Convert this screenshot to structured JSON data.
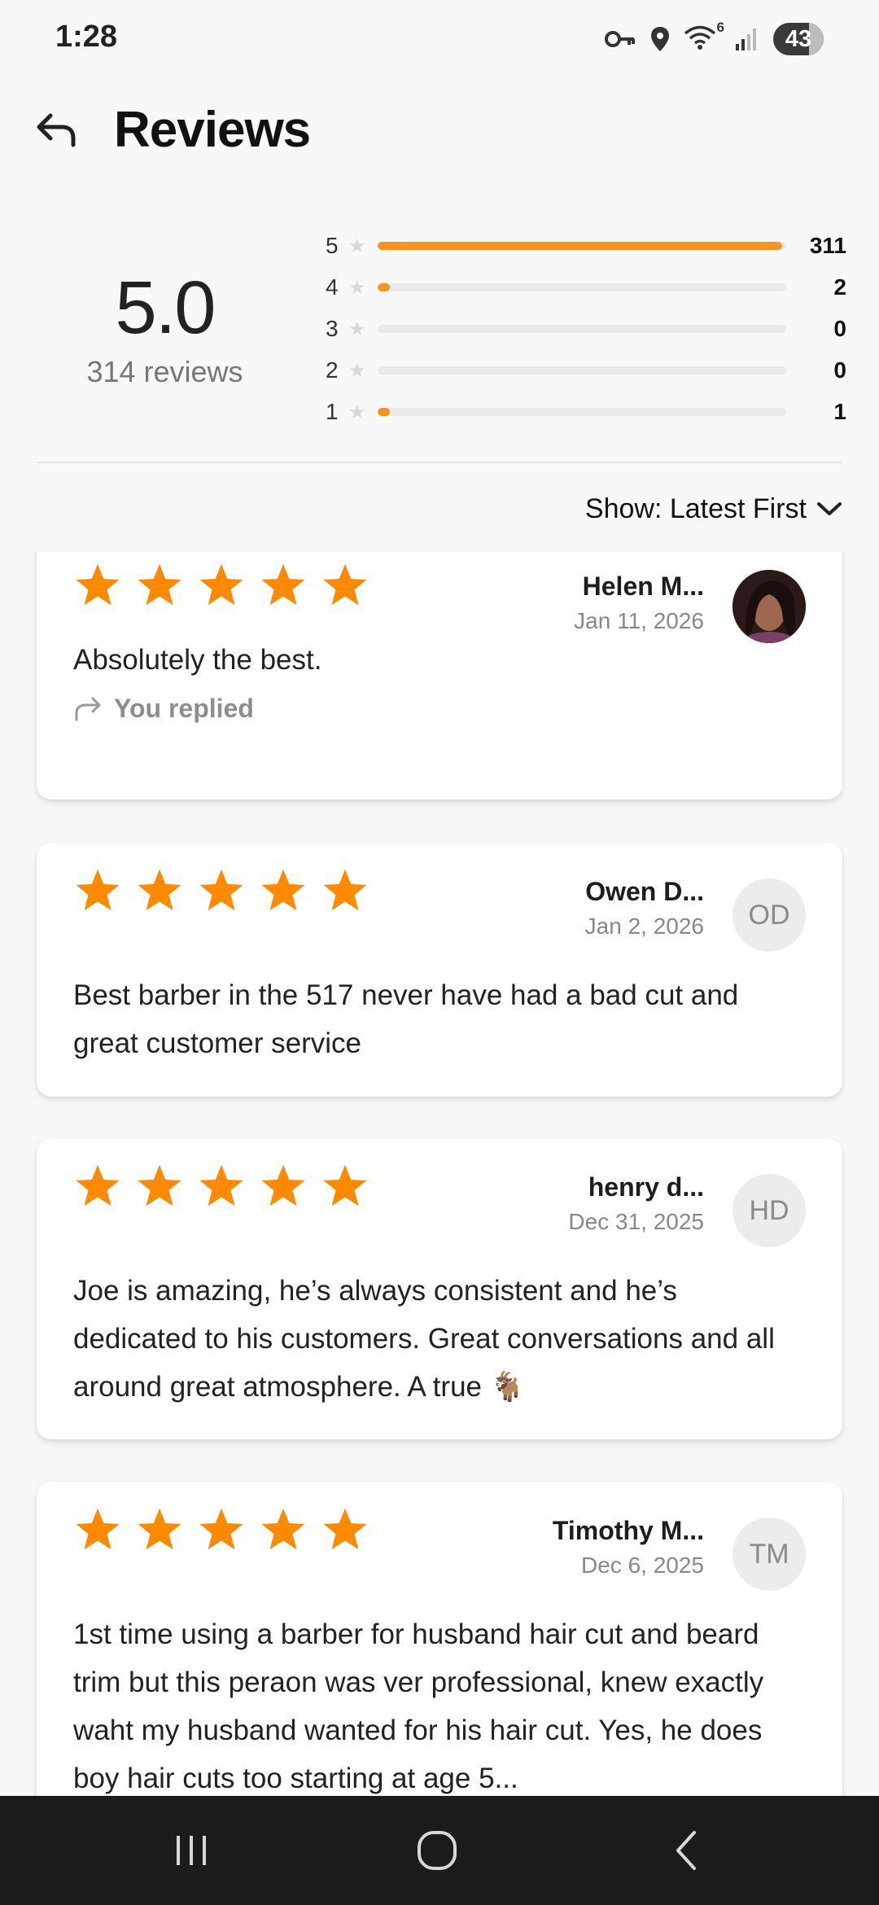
{
  "status_bar": {
    "time": "1:28",
    "wifi_badge": "6",
    "battery": "43",
    "icons": [
      "key-icon",
      "location-icon",
      "wifi-icon",
      "signal-icon",
      "battery-icon"
    ]
  },
  "header": {
    "title": "Reviews",
    "back_icon": "back-arrow-icon"
  },
  "summary": {
    "average": "5.0",
    "count_label": "314 reviews",
    "distribution": [
      {
        "stars": "5",
        "count": "311",
        "fraction": 0.99
      },
      {
        "stars": "4",
        "count": "2",
        "fraction": 0.03
      },
      {
        "stars": "3",
        "count": "0",
        "fraction": 0
      },
      {
        "stars": "2",
        "count": "0",
        "fraction": 0
      },
      {
        "stars": "1",
        "count": "1",
        "fraction": 0.03
      }
    ]
  },
  "sort": {
    "label": "Show: Latest First",
    "icon": "chevron-down-icon"
  },
  "reviews": [
    {
      "name": "Helen M...",
      "date": "Jan 11, 2026",
      "initials": "",
      "avatar": "photo",
      "rating": 5,
      "text": "Absolutely the best.",
      "replied_label": "You replied"
    },
    {
      "name": "Owen D...",
      "date": "Jan 2, 2026",
      "initials": "OD",
      "rating": 5,
      "text": "Best barber in the 517 never have had a bad cut and great customer service"
    },
    {
      "name": "henry d...",
      "date": "Dec 31, 2025",
      "initials": "HD",
      "rating": 5,
      "text": "Joe is amazing, he’s always consistent and he’s dedicated to his customers. Great conversations and all around great atmosphere. A true 🐐"
    },
    {
      "name": "Timothy M...",
      "date": "Dec 6, 2025",
      "initials": "TM",
      "rating": 5,
      "text": "1st time using a barber for husband hair cut and beard trim but this peraon was ver professional, knew exactly waht my husband wanted for his hair cut. Yes, he does boy hair cuts too starting at age 5..."
    }
  ],
  "colors": {
    "accent": "#f7941d",
    "star": "#ff8a00",
    "nav_bar": "#1b1b1b"
  },
  "nav_bar": {
    "icons": [
      "recents-icon",
      "home-icon",
      "back-icon"
    ]
  }
}
